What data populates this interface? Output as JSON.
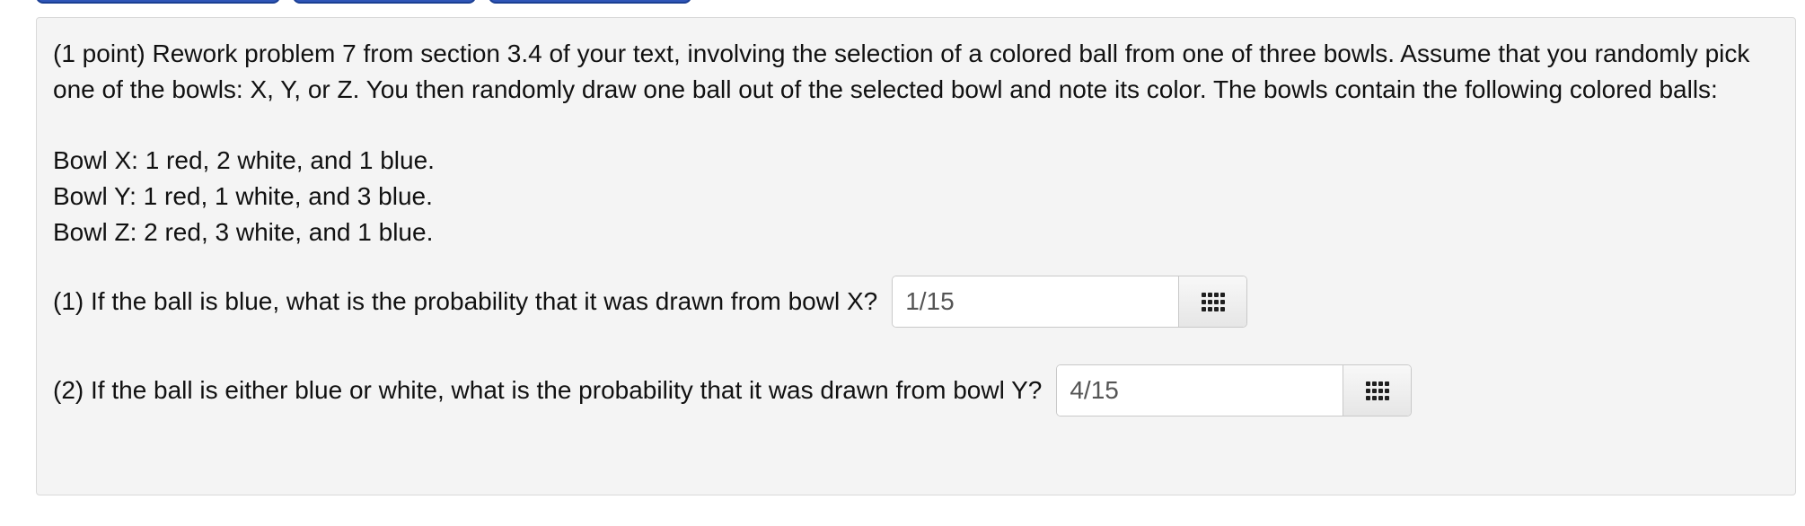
{
  "problem": {
    "intro_text": "(1 point) Rework problem 7 from section 3.4 of your text, involving the selection of a colored ball from one of three bowls. Assume that you randomly pick one of the bowls: X, Y, or Z. You then randomly draw one ball out of the selected bowl and note its color. The bowls contain the following colored balls:",
    "bowls": [
      "Bowl X: 1 red, 2 white, and 1 blue.",
      "Bowl Y: 1 red, 1 white, and 3 blue.",
      "Bowl Z: 2 red, 3 white, and 1 blue."
    ],
    "questions": [
      {
        "label": "(1) If the ball is blue, what is the probability that it was drawn from bowl X?",
        "answer": "1/15",
        "icon": "grid-icon"
      },
      {
        "label": "(2) If the ball is either blue or white, what is the probability that it was drawn from bowl Y?",
        "answer": "4/15",
        "icon": "grid-icon"
      }
    ]
  },
  "colors": {
    "panel_background": "#f4f4f4",
    "top_tab_blue": "#2f56b8",
    "input_text": "#555555"
  }
}
